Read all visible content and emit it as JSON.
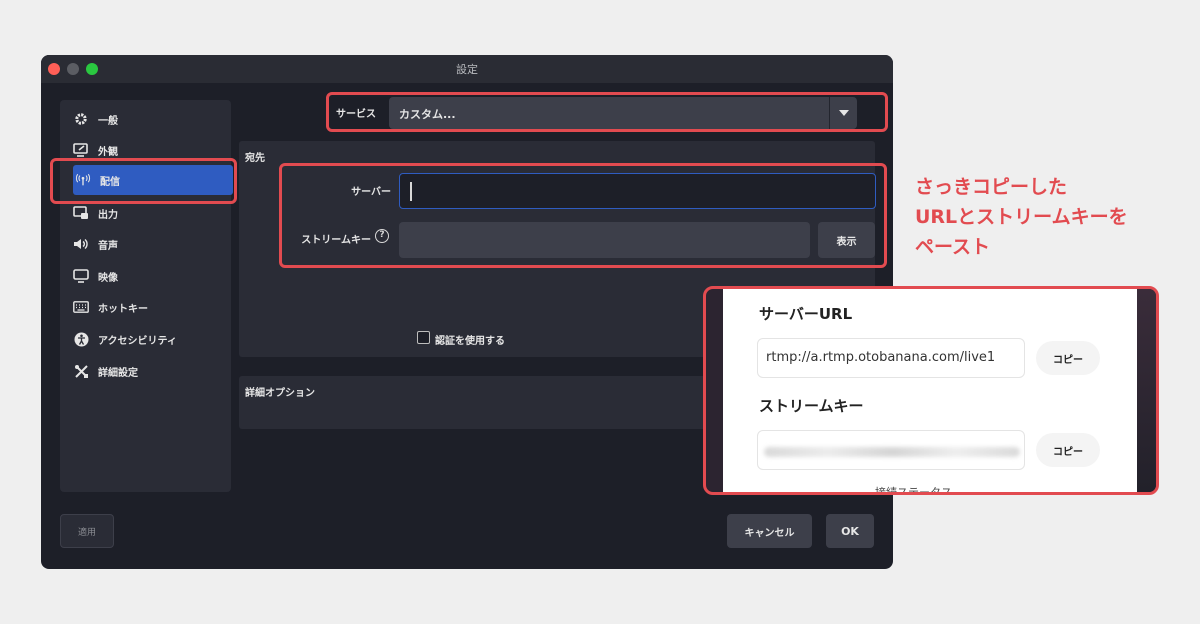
{
  "window": {
    "title": "設定"
  },
  "sidebar": {
    "items": [
      {
        "label": "一般",
        "icon": "gear-icon"
      },
      {
        "label": "外観",
        "icon": "appearance-icon"
      },
      {
        "label": "配信",
        "icon": "broadcast-icon",
        "active": true
      },
      {
        "label": "出力",
        "icon": "output-icon"
      },
      {
        "label": "音声",
        "icon": "speaker-icon"
      },
      {
        "label": "映像",
        "icon": "monitor-icon"
      },
      {
        "label": "ホットキー",
        "icon": "keyboard-icon"
      },
      {
        "label": "アクセシビリティ",
        "icon": "accessibility-icon"
      },
      {
        "label": "詳細設定",
        "icon": "tools-icon"
      }
    ]
  },
  "service": {
    "label": "サービス",
    "value": "カスタム..."
  },
  "destination": {
    "title": "宛先",
    "server_label": "サーバー",
    "server_value": "",
    "stream_key_label": "ストリームキー",
    "show_button": "表示",
    "auth_label": "認証を使用する"
  },
  "advanced": {
    "title": "詳細オプション"
  },
  "footer": {
    "apply": "適用",
    "cancel": "キャンセル",
    "ok": "OK"
  },
  "annotation": {
    "lines": [
      "さっきコピーした",
      "URLとストリームキーを",
      "ペースト"
    ]
  },
  "zoom": {
    "server_heading": "サーバーURL",
    "server_url": "rtmp://a.rtmp.otobanana.com/live1",
    "copy_label": "コピー",
    "stream_key_heading": "ストリームキー",
    "cutoff_text": "接続ステータス"
  },
  "colors": {
    "highlight": "#e24b50",
    "accent": "#2f5cc1",
    "window_bg": "#1d1f28",
    "panel_bg": "#2a2c36"
  }
}
